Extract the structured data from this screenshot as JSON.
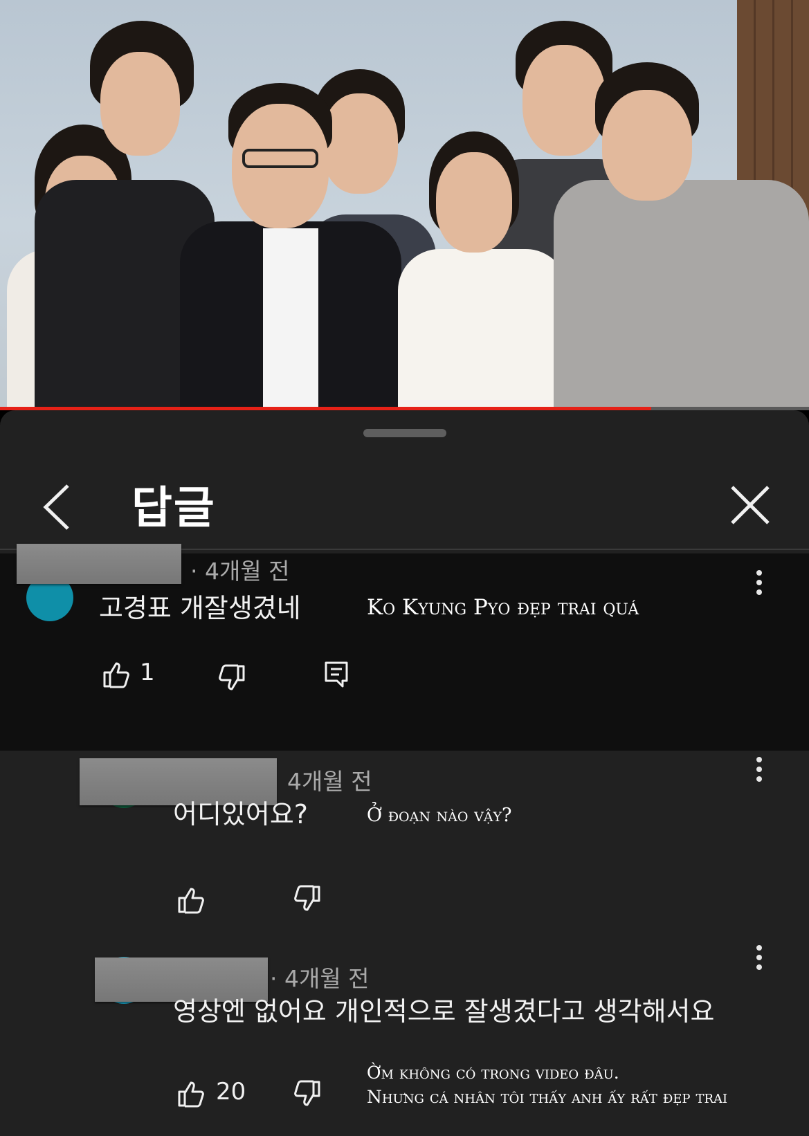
{
  "video": {
    "progress_fraction": 0.805
  },
  "sheet": {
    "title": "답글"
  },
  "comments": [
    {
      "time": "· 4개월 전",
      "text": "고경표 개잘생겼네",
      "translation": "Ko Kyung Pyo đẹp trai quá",
      "likes": "1",
      "avatar_color": "#0f8fa8"
    },
    {
      "time": "4개월 전",
      "text": "어디있어요?",
      "translation": "Ở đoạn nào vậy?",
      "likes": "",
      "avatar_color": "#0d5a3a"
    },
    {
      "time": "· 4개월 전",
      "text": "영상엔 없어요  개인적으로 잘생겼다고 생각해서요",
      "translation_line1": "Ờm không có trong video đâu.",
      "translation_line2": "Nhưng cá nhân tôi thấy anh ấy rất đẹp trai",
      "likes": "20",
      "avatar_color": "#1a9fc0"
    }
  ],
  "icons": [
    "chevron-left-icon",
    "close-icon",
    "thumbs-up-icon",
    "thumbs-down-icon",
    "reply-icon",
    "more-vert-icon"
  ],
  "colors": {
    "progress": "#e62117",
    "sheet_bg": "#212121",
    "highlight_bg": "#0f0f0f"
  }
}
